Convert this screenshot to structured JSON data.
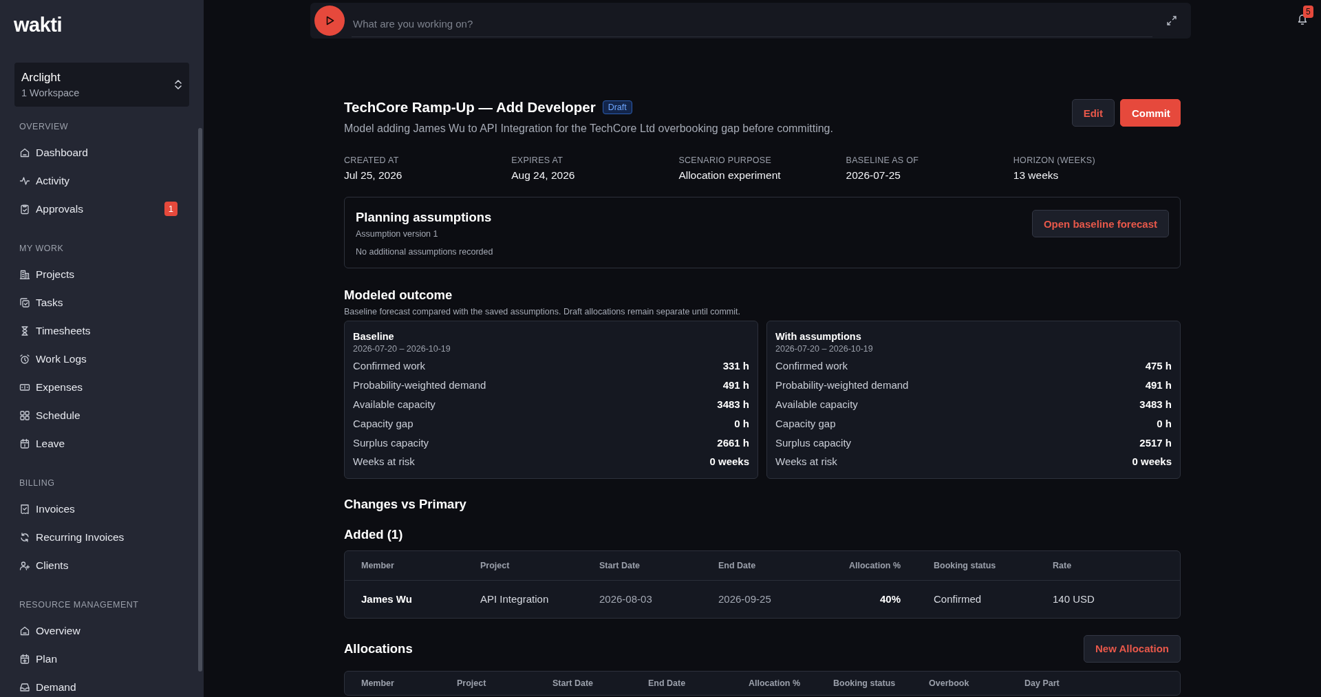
{
  "sidebar": {
    "logo": "wakti",
    "workspace": {
      "name": "Arclight",
      "subtitle": "1 Workspace"
    },
    "sections": [
      {
        "title": "OVERVIEW",
        "items": [
          {
            "label": "Dashboard",
            "selected": false
          },
          {
            "label": "Activity",
            "selected": false
          },
          {
            "label": "Approvals",
            "selected": false,
            "badge": "1"
          }
        ]
      },
      {
        "title": "MY WORK",
        "items": [
          {
            "label": "Projects",
            "selected": false
          },
          {
            "label": "Tasks",
            "selected": false
          },
          {
            "label": "Timesheets",
            "selected": false
          },
          {
            "label": "Work Logs",
            "selected": false
          },
          {
            "label": "Expenses",
            "selected": false
          },
          {
            "label": "Schedule",
            "selected": false
          },
          {
            "label": "Leave",
            "selected": false
          }
        ]
      },
      {
        "title": "BILLING",
        "items": [
          {
            "label": "Invoices",
            "selected": false
          },
          {
            "label": "Recurring Invoices",
            "selected": false
          },
          {
            "label": "Clients",
            "selected": false
          }
        ]
      },
      {
        "title": "RESOURCE MANAGEMENT",
        "items": [
          {
            "label": "Overview",
            "selected": false
          },
          {
            "label": "Plan",
            "selected": false
          },
          {
            "label": "Demand",
            "selected": false
          }
        ]
      }
    ]
  },
  "timer": {
    "placeholder": "What are you working on?"
  },
  "notifications": {
    "count": "5"
  },
  "scenario": {
    "title": "TechCore Ramp-Up — Add Developer",
    "status": "Draft",
    "description": "Model adding James Wu to API Integration for the TechCore Ltd overbooking gap before committing.",
    "actions": [
      "Edit",
      "Commit"
    ],
    "meta": [
      {
        "label": "CREATED AT",
        "value": "Jul 25, 2026"
      },
      {
        "label": "EXPIRES AT",
        "value": "Aug 24, 2026"
      },
      {
        "label": "SCENARIO PURPOSE",
        "value": "Allocation experiment"
      },
      {
        "label": "BASELINE AS OF",
        "value": "2026-07-25"
      },
      {
        "label": "HORIZON (WEEKS)",
        "value": "13 weeks"
      }
    ]
  },
  "assumptions": {
    "title": "Planning assumptions",
    "version": "Assumption version 1",
    "note": "No additional assumptions recorded",
    "button": "Open baseline forecast"
  },
  "outcome": {
    "title": "Modeled outcome",
    "subtitle": "Baseline forecast compared with the saved assumptions. Draft allocations remain separate until commit.",
    "panels": [
      {
        "title": "Baseline",
        "range": "2026-07-20 – 2026-10-19",
        "rows": [
          {
            "label": "Confirmed work",
            "value": "331 h"
          },
          {
            "label": "Probability-weighted demand",
            "value": "491 h"
          },
          {
            "label": "Available capacity",
            "value": "3483 h"
          },
          {
            "label": "Capacity gap",
            "value": "0 h"
          },
          {
            "label": "Surplus capacity",
            "value": "2661 h"
          },
          {
            "label": "Weeks at risk",
            "value": "0 weeks"
          }
        ]
      },
      {
        "title": "With assumptions",
        "range": "2026-07-20 – 2026-10-19",
        "rows": [
          {
            "label": "Confirmed work",
            "value": "475 h"
          },
          {
            "label": "Probability-weighted demand",
            "value": "491 h"
          },
          {
            "label": "Available capacity",
            "value": "3483 h"
          },
          {
            "label": "Capacity gap",
            "value": "0 h"
          },
          {
            "label": "Surplus capacity",
            "value": "2517 h"
          },
          {
            "label": "Weeks at risk",
            "value": "0 weeks"
          }
        ]
      }
    ]
  },
  "changes": {
    "title": "Changes vs Primary",
    "added_title": "Added (1)",
    "columns": [
      "Member",
      "Project",
      "Start Date",
      "End Date",
      "Allocation %",
      "Booking status",
      "Rate"
    ],
    "rows": [
      {
        "cells": [
          "James Wu",
          "API Integration",
          "2026-08-03",
          "2026-09-25",
          "40%",
          "Confirmed",
          "140 USD"
        ]
      }
    ]
  },
  "allocations": {
    "title": "Allocations",
    "button": "New Allocation",
    "columns": [
      "Member",
      "Project",
      "Start Date",
      "End Date",
      "Allocation %",
      "Booking status",
      "Overbook",
      "Day Part"
    ]
  }
}
